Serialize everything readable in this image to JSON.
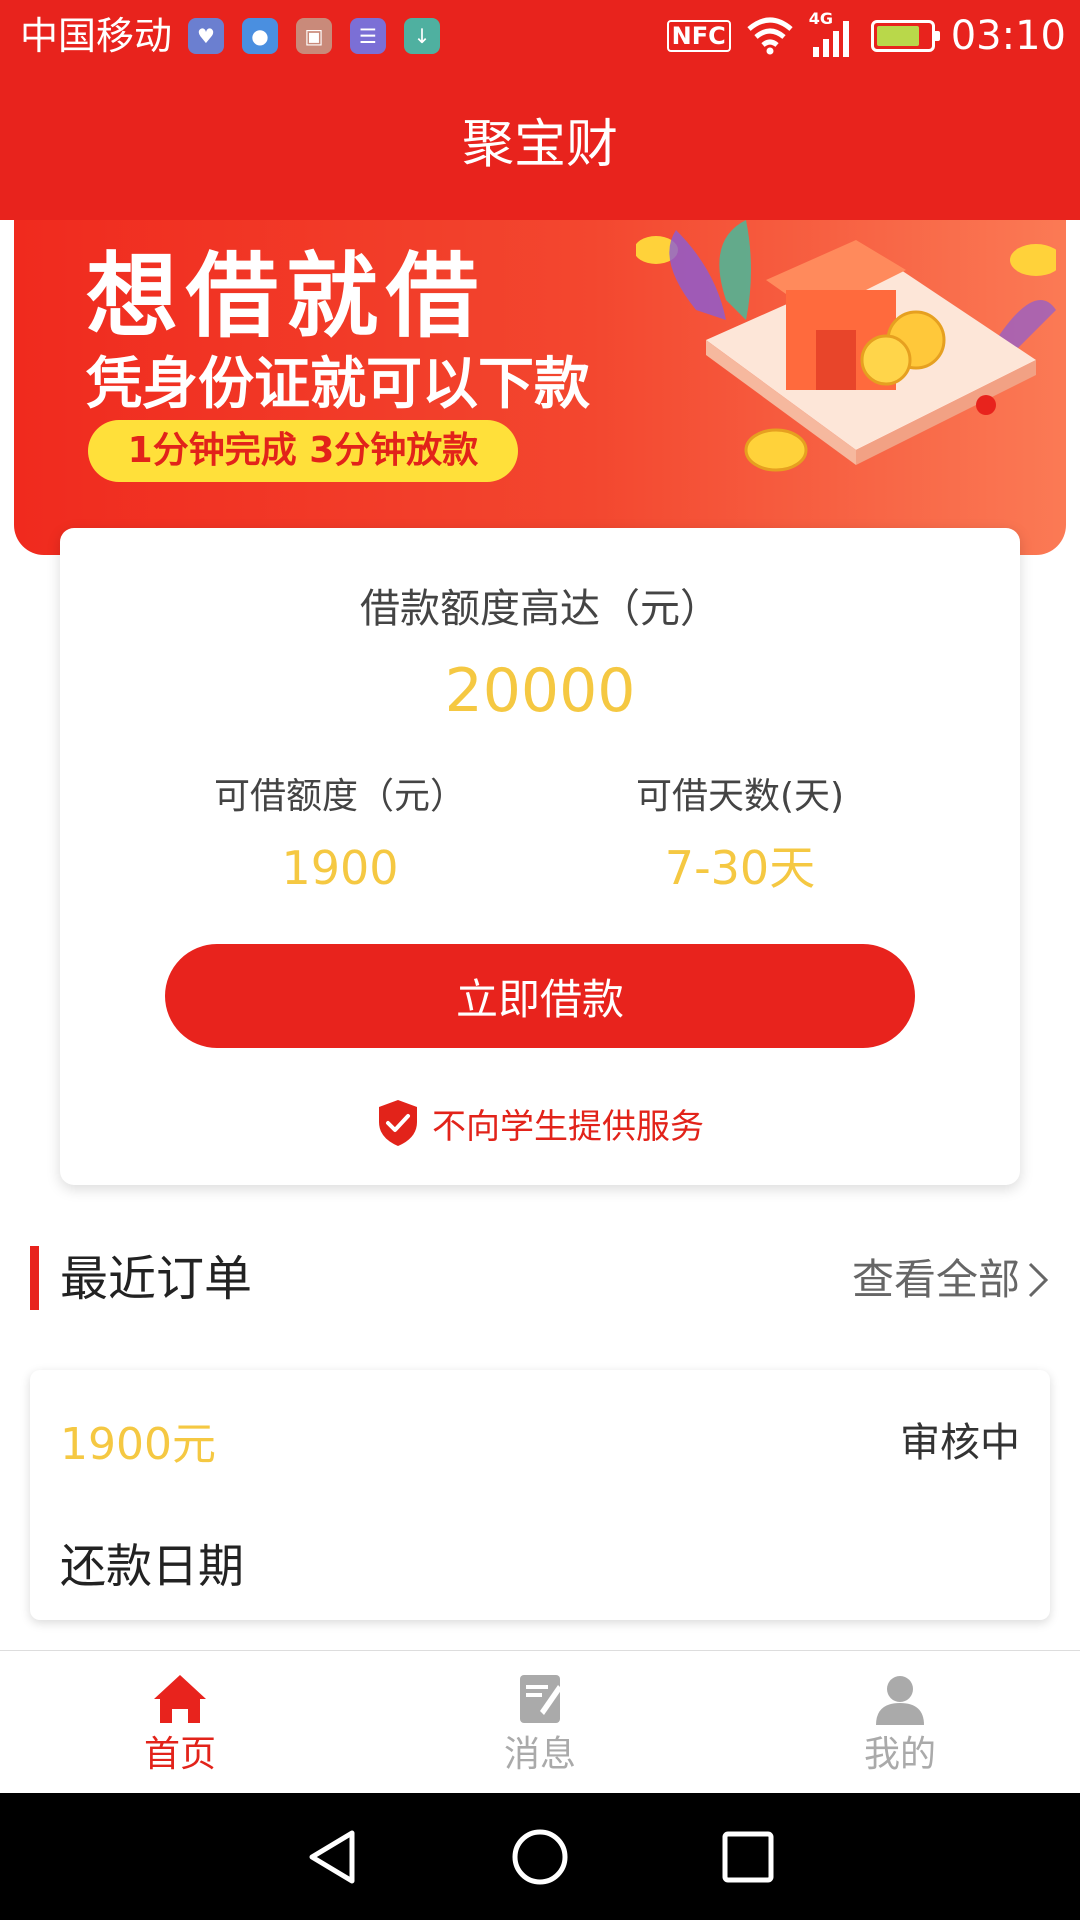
{
  "status_bar": {
    "carrier": "中国移动",
    "app_icons": [
      "health-icon",
      "chat-icon",
      "gallery-icon",
      "notes-icon",
      "download-icon"
    ],
    "nfc": "NFC",
    "network": "4G",
    "time": "03:10"
  },
  "header": {
    "title": "聚宝财"
  },
  "banner": {
    "headline": "想借就借",
    "subheadline": "凭身份证就可以下款",
    "pill": "1分钟完成 3分钟放款"
  },
  "loan_card": {
    "max_label": "借款额度高达（元）",
    "max_amount": "20000",
    "available_label": "可借额度（元）",
    "available_amount": "1900",
    "days_label": "可借天数(天)",
    "days_value": "7-30天",
    "borrow_button": "立即借款",
    "notice": "不向学生提供服务"
  },
  "recent_orders": {
    "title": "最近订单",
    "view_all": "查看全部",
    "order": {
      "amount": "1900元",
      "status": "审核中",
      "repay_label": "还款日期"
    }
  },
  "tabbar": {
    "items": [
      {
        "label": "首页",
        "icon": "home-icon",
        "active": true
      },
      {
        "label": "消息",
        "icon": "message-icon",
        "active": false
      },
      {
        "label": "我的",
        "icon": "user-icon",
        "active": false
      }
    ]
  },
  "colors": {
    "primary_red": "#e8231d",
    "gold": "#f5c842",
    "inactive": "#aaaaaa"
  }
}
